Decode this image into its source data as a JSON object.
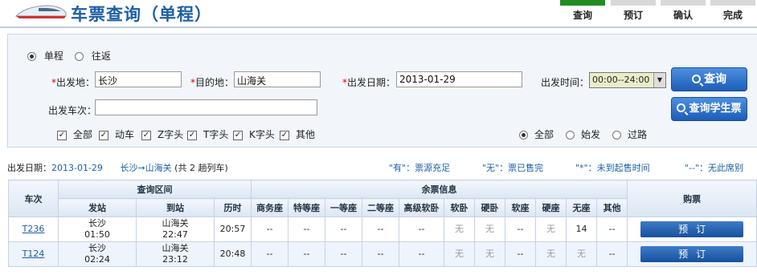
{
  "header": {
    "title": "车票查询（单程）",
    "steps": [
      "查询",
      "预订",
      "确认",
      "完成"
    ]
  },
  "search": {
    "trip_types": [
      "单程",
      "往返"
    ],
    "from_label": "出发地：",
    "from_value": "长沙",
    "to_label": "目的地：",
    "to_value": "山海关",
    "date_label": "出发日期：",
    "date_value": "2013-01-29",
    "time_label": "出发时间：",
    "time_value": "00:00--24:00",
    "train_no_label": "出发车次：",
    "train_no_value": "",
    "query_button": "查询",
    "student_button": "查询学生票",
    "train_types": [
      "全部",
      "动车",
      "Z字头",
      "T字头",
      "K字头",
      "其他"
    ],
    "station_filters": [
      "全部",
      "始发",
      "过路"
    ]
  },
  "summary": {
    "date_label": "出发日期：",
    "date_value": "2013-01-29",
    "route": "长沙→山海关",
    "count_prefix": "(共",
    "count": "2",
    "count_suffix": "趟列车)"
  },
  "legend": [
    "\"有\"：票源充足",
    "\"无\"：票已售完",
    "\"*\"：未到起售时间",
    "\"--\"：无此席别"
  ],
  "table": {
    "head_top": [
      "车次",
      "查询区间",
      "余票信息",
      "购票"
    ],
    "head_sub": [
      "发站",
      "到站",
      "历时",
      "商务座",
      "特等座",
      "一等座",
      "二等座",
      "高级软卧",
      "软卧",
      "硬卧",
      "软座",
      "硬座",
      "无座",
      "其他"
    ],
    "rows": [
      {
        "train": "T236",
        "from_station": "长沙",
        "from_time": "01:50",
        "to_station": "山海关",
        "to_time": "22:47",
        "duration": "20:57",
        "seats": [
          "--",
          "--",
          "--",
          "--",
          "--",
          "无",
          "无",
          "--",
          "无",
          "14",
          "--"
        ],
        "book": "预订"
      },
      {
        "train": "T124",
        "from_station": "长沙",
        "from_time": "02:24",
        "to_station": "山海关",
        "to_time": "23:12",
        "duration": "20:48",
        "seats": [
          "--",
          "--",
          "--",
          "--",
          "--",
          "无",
          "无",
          "--",
          "无",
          "无",
          "--"
        ],
        "book": "预订"
      }
    ]
  }
}
